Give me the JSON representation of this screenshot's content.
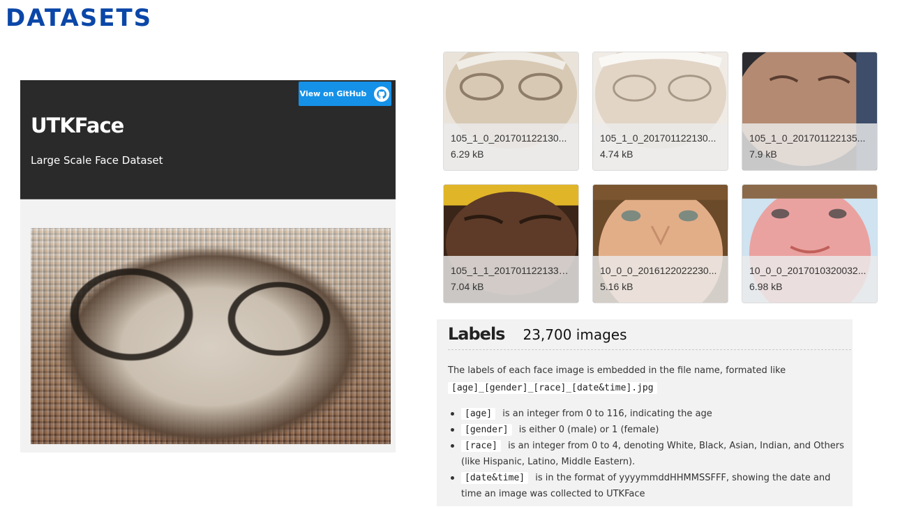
{
  "slide": {
    "title": "DATASETS"
  },
  "hero": {
    "github_label": "View on GitHub",
    "title": "UTKFace",
    "subtitle": "Large Scale Face Dataset",
    "colors": {
      "background": "#2a2a2a",
      "button": "#1591e8"
    }
  },
  "samples": [
    {
      "filename": "105_1_0_201701122130...",
      "size": "6.29 kB"
    },
    {
      "filename": "105_1_0_201701122130...",
      "size": "4.74 kB"
    },
    {
      "filename": "105_1_0_201701122135...",
      "size": "7.9 kB"
    },
    {
      "filename": "105_1_1_2017011221330...",
      "size": "7.04 kB"
    },
    {
      "filename": "10_0_0_2016122022230...",
      "size": "5.16 kB"
    },
    {
      "filename": "10_0_0_2017010320032...",
      "size": "6.98 kB"
    }
  ],
  "labels": {
    "title": "Labels",
    "count": "23,700 images",
    "description": "The labels of each face image is embedded in the file name, formated like",
    "format": "[age]_[gender]_[race]_[date&time].jpg",
    "items": [
      {
        "code": "[age]",
        "text": "is an integer from 0 to 116, indicating the age"
      },
      {
        "code": "[gender]",
        "text": "is either 0 (male) or 1 (female)"
      },
      {
        "code": "[race]",
        "text": "is an integer from 0 to 4, denoting White, Black, Asian, Indian, and Others (like Hispanic, Latino, Middle Eastern)."
      },
      {
        "code": "[date&time]",
        "text": "is in the format of yyyymmddHHMMSSFFF, showing the date and time an image was collected to UTKFace"
      }
    ]
  },
  "theme": {
    "title_color": "#0b47a8",
    "panel_bg": "#f2f2f2"
  }
}
